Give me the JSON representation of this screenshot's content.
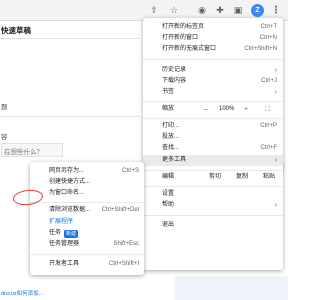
{
  "toolbar": {
    "icons": [
      "share-icon",
      "star-icon",
      "extension-icon",
      "puzzle-icon",
      "sidepanel-icon",
      "profile-icon",
      "more-icon"
    ],
    "profile_initial": "Z",
    "more_glyph": "⋮"
  },
  "page": {
    "heading": "快速草稿",
    "title_label": "题",
    "content_label": "容",
    "placeholder": "在想些什么？",
    "footer_link": "discuz如何添加..."
  },
  "menu": {
    "items": [
      {
        "label": "打开新的标签页",
        "shortcut": "Ctrl+T"
      },
      {
        "label": "打开新的窗口",
        "shortcut": "Ctrl+N"
      },
      {
        "label": "打开新的无痕式窗口",
        "shortcut": "Ctrl+Shift+N"
      },
      {
        "label": "历史记录",
        "arrow": "›"
      },
      {
        "label": "下载内容",
        "shortcut": "Ctrl+J"
      },
      {
        "label": "书签",
        "arrow": "›"
      },
      {
        "label": "打印...",
        "shortcut": "Ctrl+P"
      },
      {
        "label": "投放..."
      },
      {
        "label": "查找...",
        "shortcut": "Ctrl+F"
      },
      {
        "label": "更多工具",
        "arrow": "›"
      },
      {
        "label": "设置"
      },
      {
        "label": "帮助",
        "arrow": "›"
      },
      {
        "label": "退出"
      }
    ],
    "zoom": {
      "label": "缩放",
      "minus": "–",
      "value": "100%",
      "plus": "+",
      "fullscreen": "⛶"
    },
    "edit": {
      "label": "编辑",
      "cut": "剪切",
      "copy": "复制",
      "paste": "粘贴"
    }
  },
  "submenu": {
    "items": [
      {
        "label": "网页另存为...",
        "shortcut": "Ctrl+S"
      },
      {
        "label": "创建快捷方式..."
      },
      {
        "label": "为窗口命名..."
      },
      {
        "label": "清除浏览数据...",
        "shortcut": "Ctrl+Shift+Del"
      },
      {
        "label": "扩展程序"
      },
      {
        "label": "任务",
        "badge": "新建"
      },
      {
        "label": "任务管理器",
        "shortcut": "Shift+Esc"
      },
      {
        "label": "开发者工具",
        "shortcut": "Ctrl+Shift+I"
      }
    ]
  },
  "colors": {
    "accent": "#1a73e8",
    "annotation": "#e53935",
    "menu_hover": "#e8eaed"
  }
}
